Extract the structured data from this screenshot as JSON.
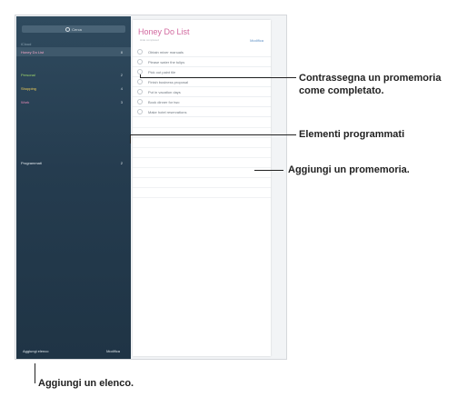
{
  "sidebar": {
    "search_label": "Cerca",
    "section_label": "iCloud",
    "lists": [
      {
        "label": "Honey Do List",
        "count": "8",
        "color": "#f4a6c8"
      },
      {
        "label": "Personal",
        "count": "2",
        "color": "#9fd66b"
      },
      {
        "label": "Shopping",
        "count": "4",
        "color": "#f2cf58"
      },
      {
        "label": "Work",
        "count": "3",
        "color": "#e88ab8"
      }
    ],
    "scheduled": {
      "label": "Programmati",
      "count": "2"
    },
    "footer": {
      "add_list": "Aggiungi elenco",
      "edit": "Modifica"
    }
  },
  "detail": {
    "title": "Honey Do List",
    "subtitle": "Hide completed",
    "edit_label": "Modifica",
    "items": [
      "Obtain mixer manuals",
      "Please water the tulips",
      "Pick out paint tile",
      "Finish business proposal",
      "Put in vacation days",
      "Book dinner for two",
      "Make hotel reservations"
    ]
  },
  "callouts": {
    "mark_complete": [
      "Contrassegna un promemoria",
      "come completato."
    ],
    "scheduled": "Elementi programmati",
    "add_reminder": "Aggiungi un promemoria.",
    "add_list": "Aggiungi un elenco."
  }
}
